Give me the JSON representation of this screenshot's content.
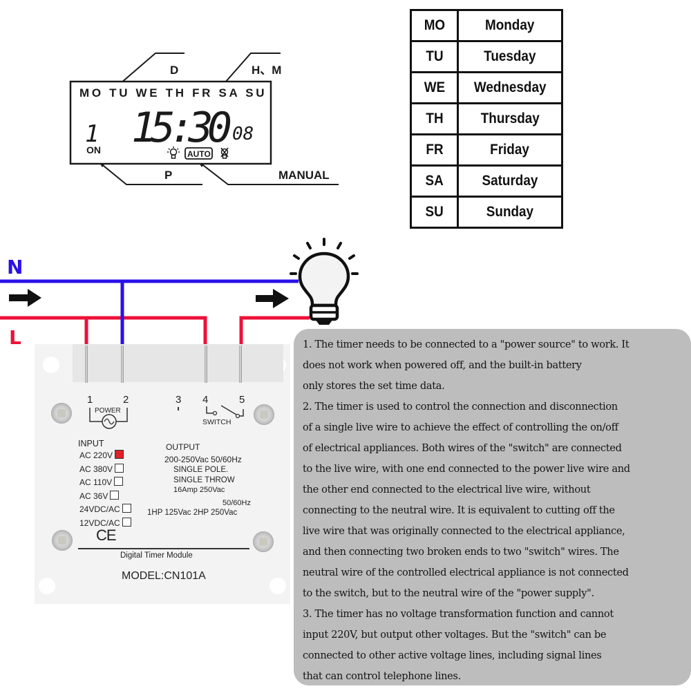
{
  "lcd": {
    "callouts": {
      "day": "D",
      "hour_minute": "H、M",
      "program": "P",
      "manual": "MANUAL"
    },
    "day_row": "MO TU WE TH FR SA SU",
    "program_number": "1",
    "time_main": "15:30",
    "seconds": "08",
    "on_label": "ON",
    "auto_label": "AUTO",
    "icons": [
      "bulb-on-icon",
      "auto-badge",
      "bulb-off-icon"
    ]
  },
  "day_table": {
    "rows": [
      {
        "abbr": "MO",
        "full": "Monday"
      },
      {
        "abbr": "TU",
        "full": "Tuesday"
      },
      {
        "abbr": "WE",
        "full": "Wednesday"
      },
      {
        "abbr": "TH",
        "full": "Thursday"
      },
      {
        "abbr": "FR",
        "full": "Friday"
      },
      {
        "abbr": "SA",
        "full": "Saturday"
      },
      {
        "abbr": "SU",
        "full": "Sunday"
      }
    ]
  },
  "wiring": {
    "neutral_label": "N",
    "live_label": "L",
    "neutral_color": "#2a10e8",
    "live_color": "#ee1138",
    "load_icon": "light-bulb-icon",
    "flow_icon": "arrow-right-icon"
  },
  "module": {
    "terminals": [
      "1",
      "2",
      "3",
      "4",
      "5"
    ],
    "power_label": "POWER",
    "switch_label": "SWITCH",
    "input_title": "INPUT",
    "inputs": [
      {
        "label": "AC 220V",
        "checked": true
      },
      {
        "label": "AC 380V",
        "checked": false
      },
      {
        "label": "AC 110V",
        "checked": false
      },
      {
        "label": "AC 36V",
        "checked": false
      },
      {
        "label": "24VDC/AC",
        "checked": false
      },
      {
        "label": "12VDC/AC",
        "checked": false
      }
    ],
    "output_title": "OUTPUT",
    "output_lines": [
      "200-250Vac  50/60Hz",
      "SINGLE  POLE.",
      "SINGLE  THROW",
      "16Amp  250Vac",
      "50/60Hz",
      "1HP  125Vac  2HP  250Vac"
    ],
    "ce_mark": "CE",
    "product_name": "Digital  Timer  Module",
    "model": "MODEL:CN101A",
    "accent_color": "#e0202a"
  },
  "notes": {
    "lines": [
      "1. The timer needs to be connected to a \"power source\" to work. It",
      "does not work when powered off, and the built-in battery",
      "only stores the set time data.",
      "2. The timer is used to control the connection and disconnection",
      "of a single live wire to achieve the effect of controlling the on/off",
      "of electrical appliances. Both wires of the \"switch\" are connected",
      "to the live wire, with one end connected to the power live wire and",
      "the other end connected to the electrical live wire, without",
      "connecting to the neutral wire. It is equivalent to cutting off the",
      "live wire that was originally connected to the electrical appliance,",
      "and then connecting two broken ends to two \"switch\" wires. The",
      "neutral wire of the controlled electrical appliance is not connected",
      "to the switch, but to the neutral wire of the \"power supply\".",
      "3. The timer has no voltage transformation function and cannot",
      "input 220V, but output other voltages. But the \"switch\" can be",
      "connected to other active voltage lines, including signal lines",
      "that can control telephone lines."
    ]
  }
}
